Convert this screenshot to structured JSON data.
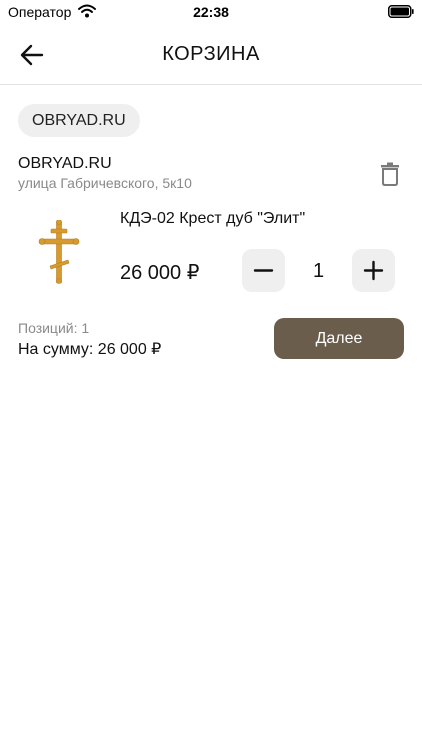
{
  "status_bar": {
    "carrier": "Оператор",
    "time": "22:38"
  },
  "header": {
    "title": "КОРЗИНА"
  },
  "shop_chip": {
    "label": "OBRYAD.RU"
  },
  "shop": {
    "name": "OBRYAD.RU",
    "address": "улица Габричевского, 5к10"
  },
  "product": {
    "name": "КДЭ-02 Крест дуб \"Элит\"",
    "price": "26 000 ₽",
    "quantity": "1"
  },
  "summary": {
    "positions": "Позиций: 1",
    "total": "На сумму: 26 000 ₽"
  },
  "actions": {
    "next_label": "Далее"
  },
  "colors": {
    "accent": "#6b5d4c",
    "cross": "#d69a2e",
    "chip_bg": "#efefef",
    "muted_text": "#8a8a8a"
  },
  "icons": {
    "back": "arrow-left-icon",
    "delete": "trash-icon",
    "decrease": "minus-icon",
    "increase": "plus-icon"
  }
}
